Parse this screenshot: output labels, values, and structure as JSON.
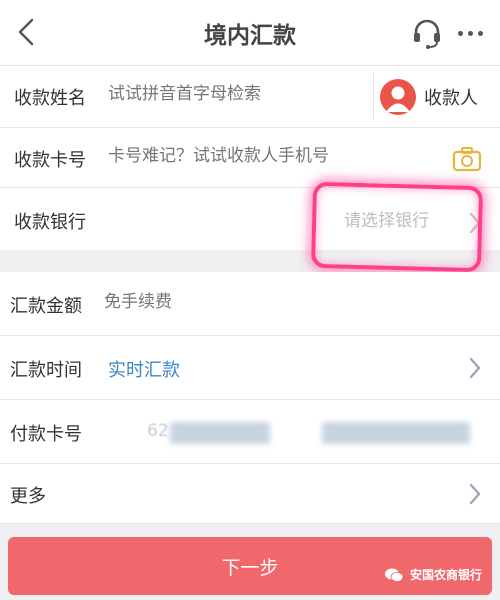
{
  "header": {
    "title": "境内汇款",
    "back_icon": "chevron-left-icon",
    "support_icon": "headset-icon",
    "more_icon": "more-dots-icon"
  },
  "form": {
    "payee_name": {
      "label": "收款姓名",
      "placeholder": "试试拼音首字母检索",
      "payee_button": "收款人"
    },
    "card_number": {
      "label": "收款卡号",
      "placeholder": "卡号难记？试试收款人手机号",
      "camera_icon": "camera-icon"
    },
    "bank": {
      "label": "收款银行",
      "select_text": "请选择银行"
    },
    "amount": {
      "label": "汇款金额",
      "placeholder": "免手续费"
    },
    "time": {
      "label": "汇款时间",
      "value": "实时汇款"
    },
    "pay_card": {
      "label": "付款卡号",
      "masked_prefix": "62"
    },
    "more": {
      "label": "更多"
    }
  },
  "footer": {
    "next_label": "下一步"
  },
  "watermark": {
    "text": "安国农商银行"
  },
  "colors": {
    "accent": "#3a86c8",
    "button": "#f0686b",
    "highlight": "#ff3f8c",
    "avatar": "#e9544b"
  }
}
